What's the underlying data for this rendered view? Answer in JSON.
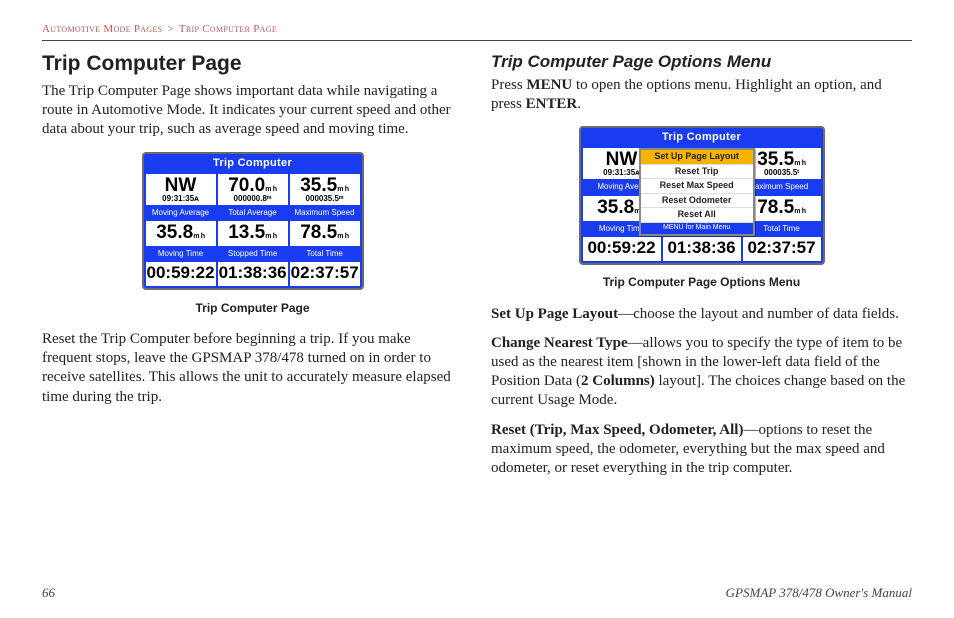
{
  "breadcrumb": {
    "section": "Automotive Mode Pages",
    "sep": ">",
    "page": "Trip Computer Page"
  },
  "left": {
    "heading": "Trip Computer Page",
    "intro": "The Trip Computer Page shows important data while navigating a route in Automotive Mode. It indicates your current speed and other data about your trip, such as average speed and moving time.",
    "device": {
      "title": "Trip Computer",
      "row1": {
        "a": {
          "big": "NW",
          "tiny": "09:31:35ᴀ"
        },
        "b": {
          "big": "70.0",
          "unit": "m h",
          "tiny": "000000.8ᵐ"
        },
        "c": {
          "big": "35.5",
          "unit": "m h",
          "tiny": "000035.5ᵐ"
        }
      },
      "labels2": [
        "Moving Average",
        "Total Average",
        "Maximum Speed"
      ],
      "row2": [
        {
          "val": "35.8",
          "unit": "m h"
        },
        {
          "val": "13.5",
          "unit": "m h"
        },
        {
          "val": "78.5",
          "unit": "m h"
        }
      ],
      "labels3": [
        "Moving Time",
        "Stopped Time",
        "Total Time"
      ],
      "row3": [
        "00:59:22",
        "01:38:36",
        "02:37:57"
      ],
      "caption": "Trip Computer Page"
    },
    "para2": "Reset the Trip Computer before beginning a trip. If you make frequent stops, leave the GPSMAP 378/478 turned on in order to receive satellites. This allows the unit to accurately measure elapsed time during the trip."
  },
  "right": {
    "heading": "Trip Computer Page Options Menu",
    "intro_pre": "Press ",
    "intro_menu": "MENU",
    "intro_mid": " to open the options menu. Highlight an option, and press ",
    "intro_enter": "ENTER",
    "intro_post": ".",
    "device": {
      "title": "Trip Computer",
      "menu": {
        "items": [
          "Set Up Page Layout",
          "Reset Trip",
          "Reset Max Speed",
          "Reset Odometer",
          "Reset All"
        ],
        "footer": "MENU for Main Menu"
      },
      "row1": {
        "a": {
          "big": "NW",
          "tiny": "09:31:35ᴀ"
        },
        "c": {
          "big": "35.5",
          "unit": "m h",
          "tiny": "000035.5ᵗ"
        }
      },
      "labels2": [
        "Moving Avera",
        "",
        "aximum Speed"
      ],
      "row2": [
        {
          "val": "35.8",
          "unit": "m h"
        },
        {
          "val": "",
          "unit": ""
        },
        {
          "val": "78.5",
          "unit": "m h"
        }
      ],
      "labels3": [
        "Moving Time",
        "Stopped Time",
        "Total Time"
      ],
      "row3": [
        "00:59:22",
        "01:38:36",
        "02:37:57"
      ],
      "caption": "Trip Computer Page Options Menu"
    },
    "opt1_bold": "Set Up Page Layout",
    "opt1_rest": "—choose the layout and number of data fields.",
    "opt2_bold": "Change Nearest Type",
    "opt2_rest_a": "—allows you to specify the type of item to be used as the nearest item [shown in the lower-left data field of the Position Data (",
    "opt2_rest_b": "2 Columns)",
    "opt2_rest_c": " layout]. The choices change based on the current Usage Mode.",
    "opt3_bold": "Reset (Trip, Max Speed, Odometer, All)",
    "opt3_rest": "—options to reset the maximum speed, the odometer, everything but the max speed and odometer, or reset everything in the trip computer."
  },
  "footer": {
    "pageno": "66",
    "manual": "GPSMAP 378/478 Owner's Manual"
  }
}
